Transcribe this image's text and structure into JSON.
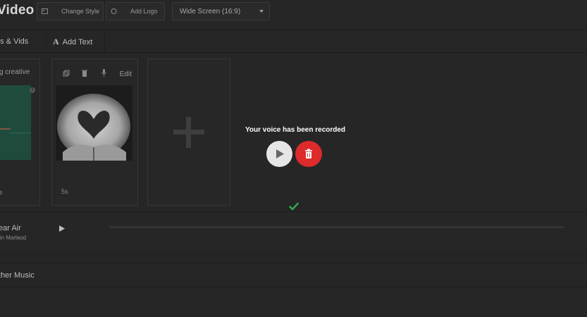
{
  "header": {
    "title": "Video",
    "change_style_label": "Change Style",
    "add_logo_label": "Add Logo",
    "aspect_select": {
      "value": "Wide Screen (16:9)"
    }
  },
  "tabs": [
    {
      "label": "os & Vids"
    },
    {
      "label": "Add Text",
      "icon": "A"
    }
  ],
  "cards": [
    {
      "caption": "g creative",
      "duration": "s"
    },
    {
      "edit_label": "Edit",
      "duration": "5s"
    },
    {
      "kind": "add-slide"
    }
  ],
  "music": {
    "song_title": "ear Air",
    "artist": "lin Marlaod",
    "other_music_label": "ther Music"
  },
  "overlay": {
    "message": "Your voice has been recorded"
  },
  "colors": {
    "background": "#262626",
    "delete_red": "#dd2a2a",
    "play_gray": "#e6e6e6",
    "success_green": "#2fa84f"
  },
  "icons": [
    "image-icon",
    "logo-icon",
    "chevron-down-icon",
    "copy-icon",
    "delete-icon",
    "microphone-icon",
    "play-icon",
    "trash-icon",
    "plus-icon",
    "checkmark-icon",
    "info-icon"
  ]
}
